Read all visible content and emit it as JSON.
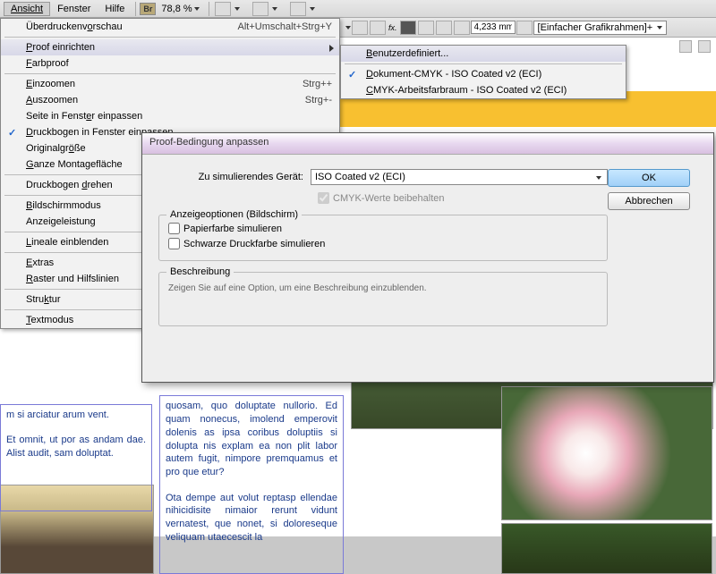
{
  "menubar": {
    "view": "Ansicht",
    "window": "Fenster",
    "help": "Hilfe",
    "zoom": "78,8 %"
  },
  "toolbar": {
    "mm_value": "4,233 mm",
    "frame_style": "[Einfacher Grafikrahmen]+"
  },
  "viewMenu": {
    "items": [
      {
        "label": "Überdruckenvorschau",
        "shortcut": "Alt+Umschalt+Strg+Y",
        "u": 12
      },
      {
        "sep": true
      },
      {
        "label": "Proof einrichten",
        "submenu": true,
        "highlighted": true,
        "u": 0
      },
      {
        "label": "Farbproof",
        "u": 0
      },
      {
        "sep": true
      },
      {
        "label": "Einzoomen",
        "shortcut": "Strg++",
        "u": 0
      },
      {
        "label": "Auszoomen",
        "shortcut": "Strg+-",
        "u": 0
      },
      {
        "label": "Seite in Fenster einpassen",
        "u": 14
      },
      {
        "label": "Druckbogen in Fenster einpassen",
        "check": true,
        "u": 0
      },
      {
        "label": "Originalgröße",
        "u": 10
      },
      {
        "label": "Ganze Montagefläche",
        "u": 0
      },
      {
        "sep": true
      },
      {
        "label": "Druckbogen drehen",
        "u": 11
      },
      {
        "sep": true
      },
      {
        "label": "Bildschirmmodus",
        "u": 0
      },
      {
        "label": "Anzeigeleistung"
      },
      {
        "sep": true
      },
      {
        "label": "Lineale einblenden",
        "u": 0
      },
      {
        "sep": true
      },
      {
        "label": "Extras",
        "u": 0
      },
      {
        "label": "Raster und Hilfslinien",
        "u": 0
      },
      {
        "sep": true
      },
      {
        "label": "Struktur",
        "u": 4
      },
      {
        "sep": true
      },
      {
        "label": "Textmodus",
        "u": 0
      }
    ]
  },
  "submenu": {
    "items": [
      {
        "label": "Benutzerdefiniert...",
        "highlighted": true,
        "u": 0
      },
      {
        "sep": true
      },
      {
        "label": "Dokument-CMYK - ISO Coated v2 (ECI)",
        "check": true,
        "u": 0
      },
      {
        "label": "CMYK-Arbeitsfarbraum - ISO Coated v2 (ECI)",
        "u": 0
      }
    ]
  },
  "dialog": {
    "title": "Proof-Bedingung anpassen",
    "deviceLabel": "Zu simulierendes Gerät:",
    "deviceValue": "ISO Coated v2 (ECI)",
    "keepCmyk": "CMYK-Werte beibehalten",
    "displayGroup": "Anzeigeoptionen (Bildschirm)",
    "paperColor": "Papierfarbe simulieren",
    "blackInk": "Schwarze Druckfarbe simulieren",
    "descGroup": "Beschreibung",
    "descText": "Zeigen Sie auf eine Option, um eine Beschreibung einzublenden.",
    "ok": "OK",
    "cancel": "Abbrechen"
  },
  "doc": {
    "col1a": "m si arciatur arum vent.",
    "col1b": "Et omnit, ut por as andam dae. Alist audit, sam doluptat.",
    "col2a": "quosam, quo doluptate nullorio. Ed quam nonecus, imolend emperovit dolenis as ipsa coribus doluptiis si dolupta nis explam ea non plit labor autem fugit, nimpore premquamus et pro que etur?",
    "col2b": "Ota dempe aut volut reptasp ellendae nihicidisite nimaior rerunt vidunt vernatest, que nonet, si doloreseque veliquam utaecescit la"
  }
}
